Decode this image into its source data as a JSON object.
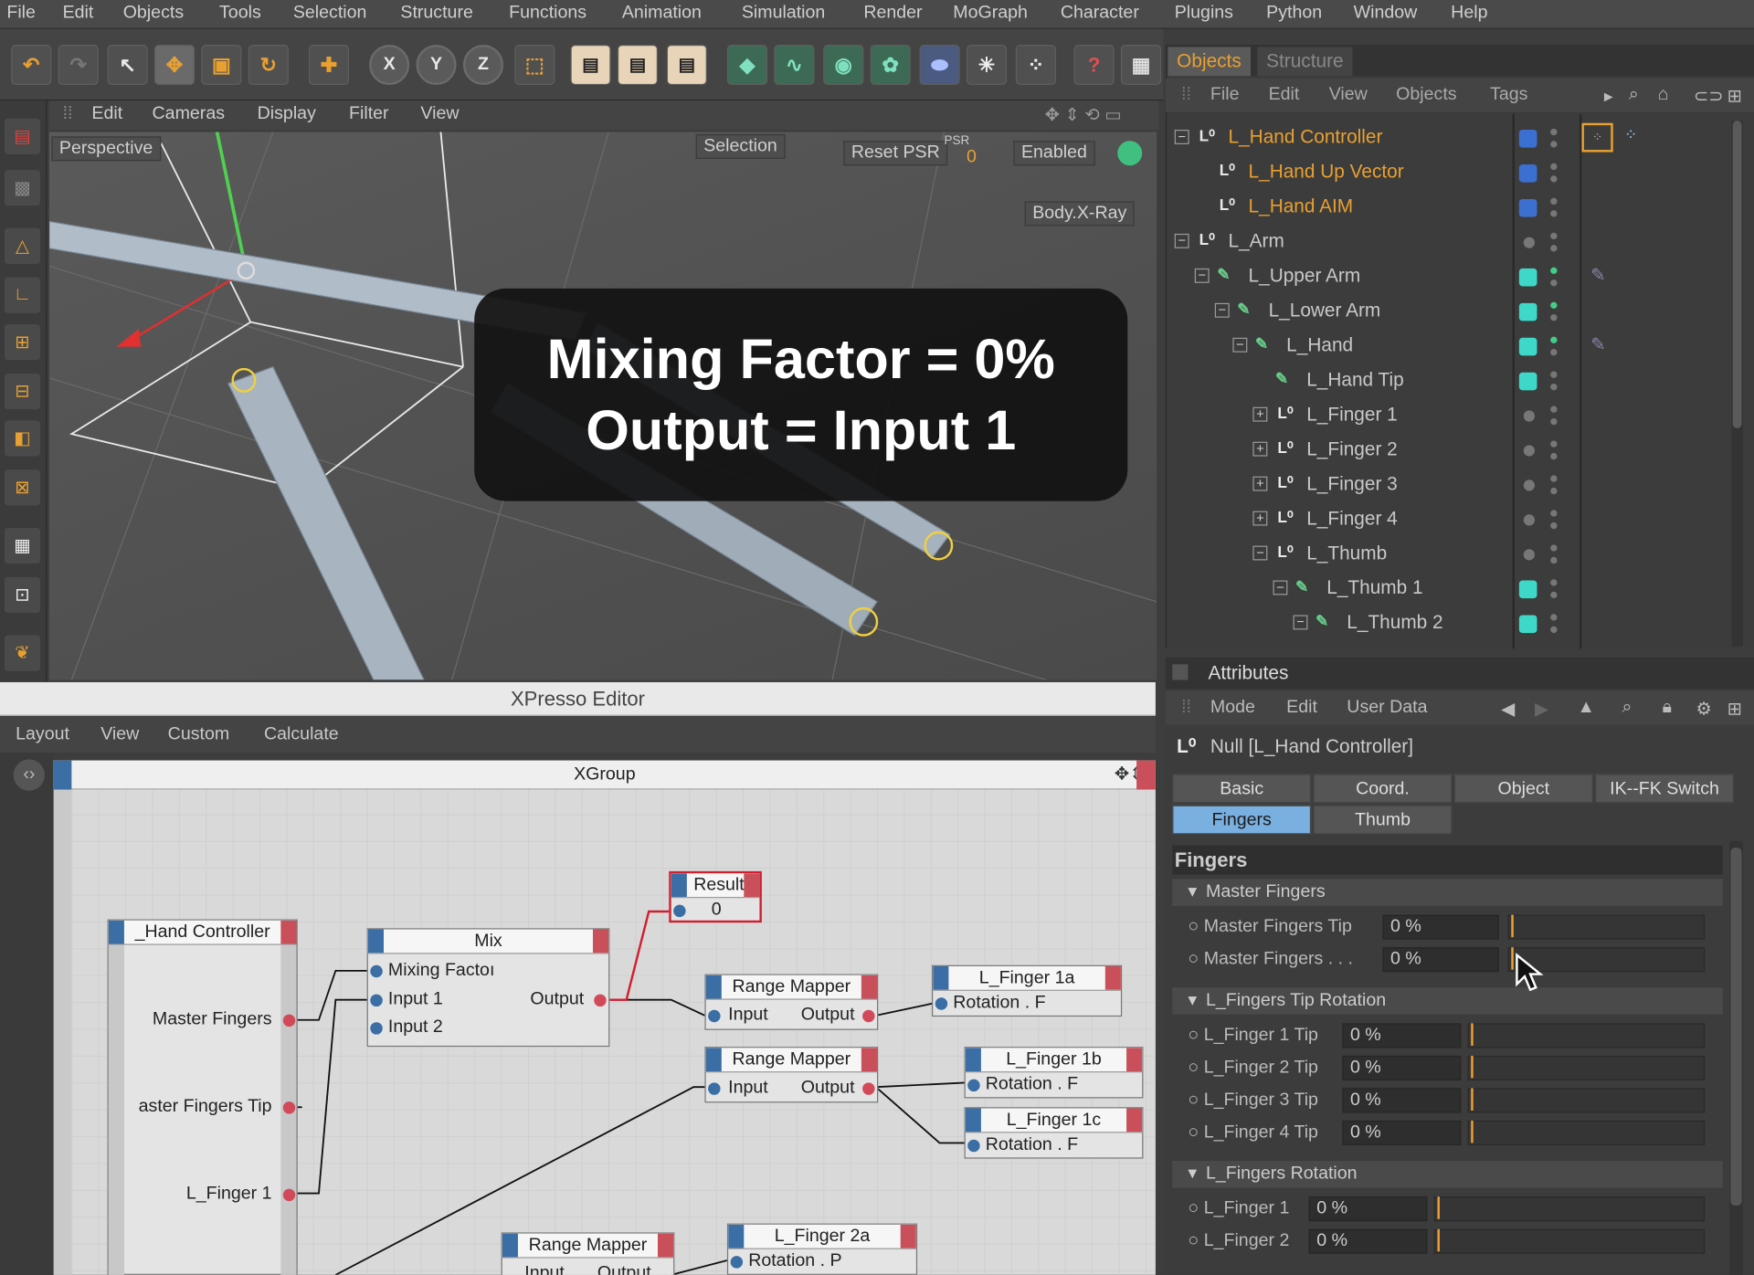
{
  "menu": [
    "File",
    "Edit",
    "Objects",
    "Tools",
    "Selection",
    "Structure",
    "Functions",
    "Animation",
    "Simulation",
    "Render",
    "MoGraph",
    "Character",
    "Plugins",
    "Python",
    "Window",
    "Help"
  ],
  "toolbar": {
    "x": "X",
    "y": "Y",
    "z": "Z"
  },
  "viewport": {
    "menu": [
      "Edit",
      "Cameras",
      "Display",
      "Filter",
      "View"
    ],
    "camera": "Perspective",
    "selection": "Selection",
    "reset": "Reset PSR",
    "psr": "PSR",
    "psr_val": "0",
    "enabled": "Enabled",
    "xray": "Body.X-Ray"
  },
  "overlay": {
    "line1": "Mixing Factor = 0%",
    "line2": "Output = Input 1"
  },
  "xpresso": {
    "title": "XPresso Editor",
    "menu": [
      "Layout",
      "View",
      "Custom",
      "Calculate"
    ],
    "group": "XGroup",
    "nodes": {
      "hand": {
        "title": "_Hand Controller",
        "p1": "Master Fingers",
        "p2": "aster Fingers Tip",
        "p3": "L_Finger 1"
      },
      "mix": {
        "title": "Mix",
        "in1": "Mixing Factoı",
        "in2": "Input 1",
        "in3": "Input 2",
        "out": "Output"
      },
      "result": {
        "title": "Result",
        "value": "0"
      },
      "rm1": {
        "title": "Range Mapper",
        "in": "Input",
        "out": "Output"
      },
      "rm2": {
        "title": "Range Mapper",
        "in": "Input",
        "out": "Output"
      },
      "rm3": {
        "title": "Range Mapper",
        "in": "Input",
        "out": "Output"
      },
      "f1a": {
        "title": "L_Finger 1a",
        "port": "Rotation . F"
      },
      "f1b": {
        "title": "L_Finger 1b",
        "port": "Rotation . F"
      },
      "f1c": {
        "title": "L_Finger 1c",
        "port": "Rotation . F"
      },
      "f2a": {
        "title": "L_Finger 2a",
        "port": "Rotation . P"
      }
    }
  },
  "objects": {
    "tabs": [
      "Objects",
      "Structure"
    ],
    "menu": [
      "File",
      "Edit",
      "View",
      "Objects",
      "Tags"
    ],
    "rows": [
      {
        "name": "L_Hand Controller",
        "color": "#e8a030"
      },
      {
        "name": "L_Hand Up Vector",
        "color": "#e8a030"
      },
      {
        "name": "L_Hand AIM",
        "color": "#e8a030"
      },
      {
        "name": "L_Arm",
        "color": "#c8c8c8"
      },
      {
        "name": "L_Upper Arm",
        "color": "#c8c8c8"
      },
      {
        "name": "L_Lower Arm",
        "color": "#c8c8c8"
      },
      {
        "name": "L_Hand",
        "color": "#c8c8c8"
      },
      {
        "name": "L_Hand Tip",
        "color": "#c8c8c8"
      },
      {
        "name": "L_Finger 1",
        "color": "#c8c8c8"
      },
      {
        "name": "L_Finger 2",
        "color": "#c8c8c8"
      },
      {
        "name": "L_Finger 3",
        "color": "#c8c8c8"
      },
      {
        "name": "L_Finger 4",
        "color": "#c8c8c8"
      },
      {
        "name": "L_Thumb",
        "color": "#c8c8c8"
      },
      {
        "name": "L_Thumb 1",
        "color": "#c8c8c8"
      },
      {
        "name": "L_Thumb 2",
        "color": "#c8c8c8"
      }
    ]
  },
  "attributes": {
    "title": "Attributes",
    "menu": [
      "Mode",
      "Edit",
      "User Data"
    ],
    "object": "Null [L_Hand Controller]",
    "tabs": [
      "Basic",
      "Coord.",
      "Object",
      "IK--FK Switch",
      "Fingers",
      "Thumb"
    ],
    "section": "Fingers",
    "groups": [
      "Master Fingers",
      "L_Fingers Tip Rotation",
      "L_Fingers Rotation"
    ],
    "params": [
      {
        "label": "Master Fingers Tip",
        "value": "0 %",
        "level": 0
      },
      {
        "label": "Master Fingers . . .",
        "value": "0 %",
        "level": 0
      },
      {
        "label": "L_Finger 1 Tip",
        "value": "0 %",
        "level": 0
      },
      {
        "label": "L_Finger 2 Tip",
        "value": "0 %",
        "level": 0
      },
      {
        "label": "L_Finger 3 Tip",
        "value": "0 %",
        "level": 0
      },
      {
        "label": "L_Finger 4 Tip",
        "value": "0 %",
        "level": 0
      },
      {
        "label": "L_Finger 1",
        "value": "0 %",
        "level": 0
      },
      {
        "label": "L_Finger 2",
        "value": "0 %",
        "level": 0
      }
    ]
  },
  "colors": {
    "accent": "#e8a030",
    "teal": "#3dd8c8",
    "blue": "#3a6ea5",
    "red": "#c9505a"
  }
}
